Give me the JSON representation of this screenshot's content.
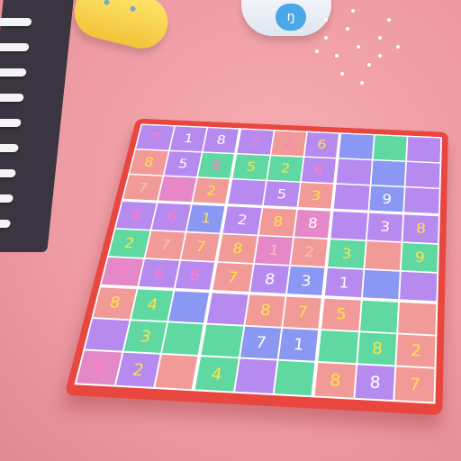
{
  "toy_badge": "ŋ",
  "palette": {
    "p": "#b78af0",
    "s": "#f29a98",
    "g": "#5fd8a2",
    "b": "#8a98f4",
    "k": "#e488c8"
  },
  "text_colors": {
    "w": "#ffffff",
    "y": "#ffe34a",
    "pk": "#ff7cc6",
    "l": "#f7c0c0"
  },
  "board": {
    "rows": [
      [
        {
          "v": "7",
          "bg": "p",
          "fg": "pk"
        },
        {
          "v": "1",
          "bg": "p",
          "fg": "w"
        },
        {
          "v": "8",
          "bg": "p",
          "fg": "w"
        },
        {
          "v": "2",
          "bg": "p",
          "fg": "pk"
        },
        {
          "v": "2",
          "bg": "s",
          "fg": "pk"
        },
        {
          "v": "6",
          "bg": "p",
          "fg": "y"
        },
        {
          "v": "",
          "bg": "b",
          "fg": "w"
        },
        {
          "v": "",
          "bg": "g",
          "fg": "w"
        },
        {
          "v": "",
          "bg": "p",
          "fg": "w"
        }
      ],
      [
        {
          "v": "8",
          "bg": "s",
          "fg": "y"
        },
        {
          "v": "5",
          "bg": "p",
          "fg": "w"
        },
        {
          "v": "8",
          "bg": "g",
          "fg": "pk"
        },
        {
          "v": "5",
          "bg": "g",
          "fg": "y"
        },
        {
          "v": "2",
          "bg": "g",
          "fg": "y"
        },
        {
          "v": "6",
          "bg": "p",
          "fg": "pk"
        },
        {
          "v": "",
          "bg": "p",
          "fg": "w"
        },
        {
          "v": "",
          "bg": "b",
          "fg": "w"
        },
        {
          "v": "",
          "bg": "p",
          "fg": "w"
        }
      ],
      [
        {
          "v": "7",
          "bg": "s",
          "fg": "l"
        },
        {
          "v": "6",
          "bg": "k",
          "fg": "pk"
        },
        {
          "v": "2",
          "bg": "s",
          "fg": "y"
        },
        {
          "v": "",
          "bg": "p",
          "fg": "w"
        },
        {
          "v": "5",
          "bg": "p",
          "fg": "w"
        },
        {
          "v": "3",
          "bg": "s",
          "fg": "y"
        },
        {
          "v": "",
          "bg": "p",
          "fg": "w"
        },
        {
          "v": "9",
          "bg": "b",
          "fg": "w"
        },
        {
          "v": "",
          "bg": "p",
          "fg": "w"
        }
      ],
      [
        {
          "v": "8",
          "bg": "p",
          "fg": "pk"
        },
        {
          "v": "6",
          "bg": "p",
          "fg": "pk"
        },
        {
          "v": "1",
          "bg": "b",
          "fg": "y"
        },
        {
          "v": "2",
          "bg": "p",
          "fg": "w"
        },
        {
          "v": "8",
          "bg": "s",
          "fg": "y"
        },
        {
          "v": "8",
          "bg": "k",
          "fg": "w"
        },
        {
          "v": "",
          "bg": "p",
          "fg": "w"
        },
        {
          "v": "3",
          "bg": "p",
          "fg": "w"
        },
        {
          "v": "8",
          "bg": "p",
          "fg": "y"
        }
      ],
      [
        {
          "v": "2",
          "bg": "g",
          "fg": "y"
        },
        {
          "v": "7",
          "bg": "s",
          "fg": "l"
        },
        {
          "v": "7",
          "bg": "s",
          "fg": "y"
        },
        {
          "v": "8",
          "bg": "s",
          "fg": "y"
        },
        {
          "v": "1",
          "bg": "k",
          "fg": "l"
        },
        {
          "v": "2",
          "bg": "s",
          "fg": "l"
        },
        {
          "v": "3",
          "bg": "g",
          "fg": "y"
        },
        {
          "v": "",
          "bg": "s",
          "fg": "w"
        },
        {
          "v": "9",
          "bg": "g",
          "fg": "y"
        }
      ],
      [
        {
          "v": "6",
          "bg": "k",
          "fg": "pk"
        },
        {
          "v": "6",
          "bg": "p",
          "fg": "pk"
        },
        {
          "v": "6",
          "bg": "p",
          "fg": "pk"
        },
        {
          "v": "7",
          "bg": "s",
          "fg": "y"
        },
        {
          "v": "8",
          "bg": "p",
          "fg": "w"
        },
        {
          "v": "3",
          "bg": "b",
          "fg": "w"
        },
        {
          "v": "1",
          "bg": "p",
          "fg": "w"
        },
        {
          "v": "",
          "bg": "b",
          "fg": "w"
        },
        {
          "v": "",
          "bg": "p",
          "fg": "w"
        }
      ],
      [
        {
          "v": "8",
          "bg": "s",
          "fg": "y"
        },
        {
          "v": "4",
          "bg": "g",
          "fg": "y"
        },
        {
          "v": "",
          "bg": "b",
          "fg": "w"
        },
        {
          "v": "",
          "bg": "p",
          "fg": "w"
        },
        {
          "v": "8",
          "bg": "s",
          "fg": "y"
        },
        {
          "v": "7",
          "bg": "s",
          "fg": "y"
        },
        {
          "v": "5",
          "bg": "s",
          "fg": "y"
        },
        {
          "v": "",
          "bg": "g",
          "fg": "w"
        },
        {
          "v": "",
          "bg": "s",
          "fg": "w"
        }
      ],
      [
        {
          "v": "",
          "bg": "p",
          "fg": "w"
        },
        {
          "v": "3",
          "bg": "g",
          "fg": "y"
        },
        {
          "v": "",
          "bg": "g",
          "fg": "w"
        },
        {
          "v": "",
          "bg": "g",
          "fg": "w"
        },
        {
          "v": "7",
          "bg": "b",
          "fg": "w"
        },
        {
          "v": "1",
          "bg": "b",
          "fg": "w"
        },
        {
          "v": "",
          "bg": "g",
          "fg": "w"
        },
        {
          "v": "8",
          "bg": "g",
          "fg": "y"
        },
        {
          "v": "2",
          "bg": "s",
          "fg": "y"
        }
      ],
      [
        {
          "v": "6",
          "bg": "k",
          "fg": "pk"
        },
        {
          "v": "2",
          "bg": "p",
          "fg": "y"
        },
        {
          "v": "",
          "bg": "s",
          "fg": "w"
        },
        {
          "v": "4",
          "bg": "g",
          "fg": "y"
        },
        {
          "v": "",
          "bg": "p",
          "fg": "w"
        },
        {
          "v": "",
          "bg": "g",
          "fg": "w"
        },
        {
          "v": "8",
          "bg": "s",
          "fg": "y"
        },
        {
          "v": "8",
          "bg": "p",
          "fg": "w"
        },
        {
          "v": "7",
          "bg": "s",
          "fg": "y"
        }
      ]
    ]
  }
}
